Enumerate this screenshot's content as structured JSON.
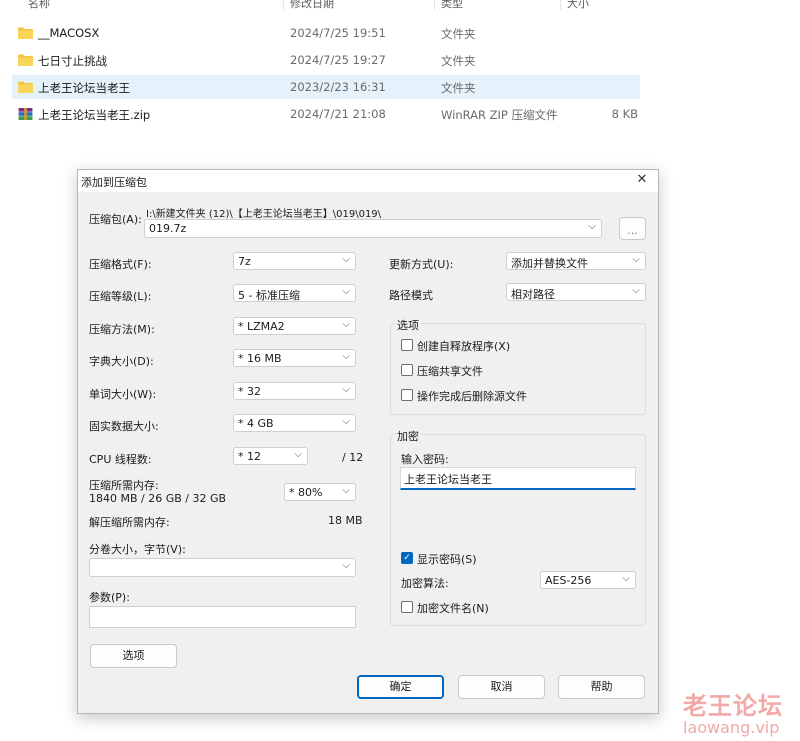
{
  "explorer": {
    "columns": {
      "name": "名称",
      "date": "修改日期",
      "type": "类型",
      "size": "大小"
    },
    "rows": [
      {
        "name": "__MACOSX",
        "date": "2024/7/25 19:51",
        "type": "文件夹",
        "size": "",
        "icon": "folder-icon"
      },
      {
        "name": "七日寸止挑战",
        "date": "2024/7/25 19:27",
        "type": "文件夹",
        "size": "",
        "icon": "folder-icon"
      },
      {
        "name": "上老王论坛当老王",
        "date": "2023/2/23 16:31",
        "type": "文件夹",
        "size": "",
        "icon": "folder-icon",
        "selected": true
      },
      {
        "name": "上老王论坛当老王.zip",
        "date": "2024/7/21 21:08",
        "type": "WinRAR ZIP 压缩文件",
        "size": "8 KB",
        "icon": "winrar-archive-icon"
      }
    ]
  },
  "dialog": {
    "title": "添加到压缩包",
    "close": "✕",
    "archive_label": "压缩包(A):",
    "archive_path": "I:\\新建文件夹 (12)\\【上老王论坛当老王】\\019\\019\\",
    "archive_name": "019.7z",
    "browse": "...",
    "format": {
      "label": "压缩格式(F):",
      "value": "7z"
    },
    "level": {
      "label": "压缩等级(L):",
      "value": "5 - 标准压缩"
    },
    "method": {
      "label": "压缩方法(M):",
      "value": "* LZMA2"
    },
    "dict": {
      "label": "字典大小(D):",
      "value": "* 16 MB"
    },
    "word": {
      "label": "单词大小(W):",
      "value": "* 32"
    },
    "solid": {
      "label": "固实数据大小:",
      "value": "* 4 GB"
    },
    "threads": {
      "label": "CPU 线程数:",
      "value": "* 12",
      "max": "/ 12"
    },
    "memory": {
      "label": "压缩所需内存:",
      "detail": "1840 MB / 26 GB / 32 GB",
      "value": "* 80%"
    },
    "decomp": {
      "label": "解压缩所需内存:",
      "value": "18 MB"
    },
    "split": {
      "label": "分卷大小，字节(V):",
      "value": ""
    },
    "params": {
      "label": "参数(P):",
      "value": ""
    },
    "options_button": "选项",
    "update": {
      "label": "更新方式(U):",
      "value": "添加并替换文件"
    },
    "pathmode": {
      "label": "路径模式",
      "value": "相对路径"
    },
    "options_group": {
      "title": "选项",
      "sfx": "创建自释放程序(X)",
      "shared": "压缩共享文件",
      "delete": "操作完成后删除源文件"
    },
    "encryption": {
      "title": "加密",
      "password_label": "输入密码:",
      "password": "上老王论坛当老王",
      "show_password": "显示密码(S)",
      "show_password_checked": true,
      "method_label": "加密算法:",
      "method": "AES-256",
      "encrypt_names": "加密文件名(N)"
    },
    "ok": "确定",
    "cancel": "取消",
    "help": "帮助"
  },
  "watermark": {
    "line1": "老王论坛",
    "line2": "laowang.vip"
  },
  "colors": {
    "accent": "#0067c0",
    "selection": "#e5f1fb",
    "folder": "#f4c542"
  }
}
